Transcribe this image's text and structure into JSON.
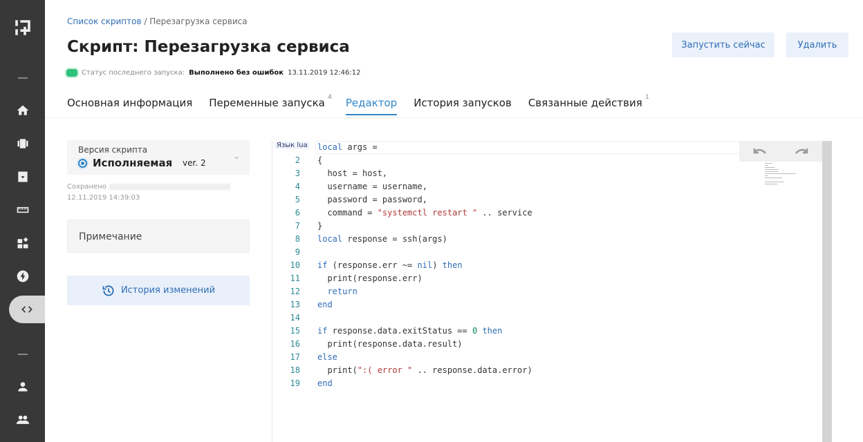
{
  "sidebar": {
    "items": [
      "logo",
      "minus",
      "home",
      "inventory",
      "archive",
      "ruler",
      "widgets",
      "bolt",
      "code",
      "minus",
      "user",
      "users"
    ]
  },
  "breadcrumb": {
    "link": "Список скриптов",
    "current": "/ Перезагрузка сервиса"
  },
  "title": "Скрипт: Перезагрузка сервиса",
  "status": {
    "label": "Статус последнего запуска:",
    "value": "Выполнено без ошибок",
    "time": "13.11.2019 12:46:12",
    "color": "#2ec27e"
  },
  "buttons": {
    "run": "Запустить сейчас",
    "delete": "Удалить"
  },
  "tabs": [
    {
      "label": "Основная информация"
    },
    {
      "label": "Переменные запуска",
      "badge": "4"
    },
    {
      "label": "Редактор"
    },
    {
      "label": "История запусков"
    },
    {
      "label": "Связанные действия",
      "badge": "1"
    }
  ],
  "version": {
    "label": "Версия скрипта",
    "selected": "Исполняемая",
    "ver": "ver. 2"
  },
  "saved": {
    "label": "Сохранено",
    "date": "12.11.2019 14:39:03"
  },
  "note": "Примечание",
  "history": "История изменений",
  "editor": {
    "lang": "Язык lua",
    "lines": [
      "<span class=kw>local</span> args =",
      "{",
      "  host = host,",
      "  username = username,",
      "  password = password,",
      "  command = <span class=st>\"systemctl restart \"</span> .. service",
      "}",
      "<span class=kw>local</span> response = ssh(args)",
      "",
      "<span class=kw>if</span> (response.err ~= <span class=kw>nil</span>) <span class=kw>then</span>",
      "  print(response.err)",
      "  <span class=kw>return</span>",
      "<span class=kw>end</span>",
      "",
      "<span class=kw>if</span> response.data.exitStatus == <span class=nm>0</span> <span class=kw>then</span>",
      "  print(response.data.result)",
      "<span class=kw>else</span>",
      "  print(<span class=st>\":( error \"</span> .. response.data.error)",
      "<span class=kw>end</span>"
    ]
  }
}
